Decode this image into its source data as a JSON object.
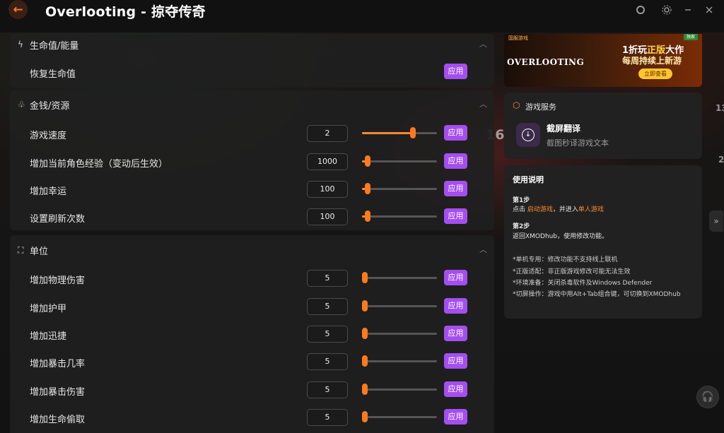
{
  "window": {
    "title": "Overlooting - 掠夺传奇"
  },
  "background_text": {
    "left_number": "16",
    "edge_number": "13",
    "edge_number2": "2"
  },
  "sections": [
    {
      "title": "生命值/能量",
      "icon": "lightning-icon",
      "rows": [
        {
          "label": "恢复生命值",
          "apply": "应用"
        }
      ]
    },
    {
      "title": "金钱/资源",
      "icon": "money-bag-icon",
      "rows": [
        {
          "label": "游戏速度",
          "value": "2",
          "slider_fraction": 0.68,
          "apply": "应用"
        },
        {
          "label": "增加当前角色经验（变动后生效）",
          "value": "1000",
          "slider_fraction": 0.08,
          "apply": "应用"
        },
        {
          "label": "增加幸运",
          "value": "100",
          "slider_fraction": 0.08,
          "apply": "应用"
        },
        {
          "label": "设置刷新次数",
          "value": "100",
          "slider_fraction": 0.08,
          "apply": "应用"
        }
      ]
    },
    {
      "title": "单位",
      "icon": "unit-nodes-icon",
      "rows": [
        {
          "label": "增加物理伤害",
          "value": "5",
          "slider_fraction": 0.04,
          "apply": "应用"
        },
        {
          "label": "增加护甲",
          "value": "5",
          "slider_fraction": 0.04,
          "apply": "应用"
        },
        {
          "label": "增加迅捷",
          "value": "5",
          "slider_fraction": 0.04,
          "apply": "应用"
        },
        {
          "label": "增加暴击几率",
          "value": "5",
          "slider_fraction": 0.04,
          "apply": "应用"
        },
        {
          "label": "增加暴击伤害",
          "value": "5",
          "slider_fraction": 0.04,
          "apply": "应用"
        },
        {
          "label": "增加生命偷取",
          "value": "5",
          "slider_fraction": 0.04,
          "apply": "应用"
        }
      ]
    }
  ],
  "ad": {
    "publisher": "国服游戏",
    "game_logo": "OVERLOOTING",
    "tag": "独家",
    "line1_a": "1折玩",
    "line1_b": "正版",
    "line1_c": "大作",
    "line2": "每周持续上新游",
    "button": "立即查看"
  },
  "service": {
    "title": "游戏服务",
    "item_name": "截屏翻译",
    "item_desc": "截图秒译游戏文本"
  },
  "usage": {
    "title": "使用说明",
    "step1_title": "第1步",
    "step1_a": "点击 ",
    "step1_link1": "启动游戏",
    "step1_b": "，并进入",
    "step1_link2": "单人游戏",
    "step2_title": "第2步",
    "step2_text": "返回XMODhub，使用修改功能。",
    "notes": [
      "*单机专用：修改功能不支持线上联机",
      "*正版适配：非正版游戏修改可能无法生效",
      "*环境准备：关闭杀毒软件及Windows Defender",
      "*切屏操作：游戏中用Alt+Tab组合键，可切换到XMODhub"
    ]
  },
  "colors": {
    "accent": "#ff8a2b",
    "apply": "#a54ef0"
  }
}
